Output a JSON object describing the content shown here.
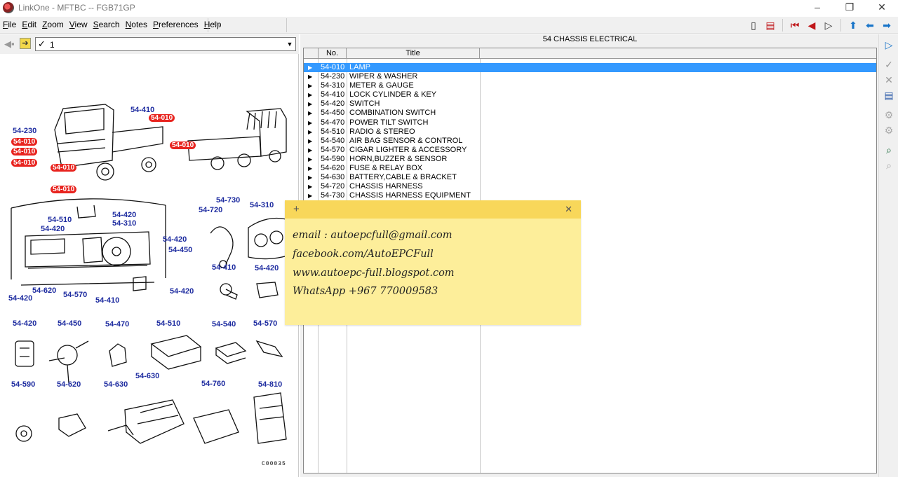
{
  "window": {
    "title": "LinkOne - MFTBC -- FGB71GP",
    "controls": [
      "–",
      "❐",
      "✕"
    ]
  },
  "menu": {
    "items": [
      "File",
      "Edit",
      "Zoom",
      "View",
      "Search",
      "Notes",
      "Preferences",
      "Help"
    ]
  },
  "left": {
    "combo_value": "1",
    "callouts": {
      "c_54410a": "54-410",
      "c_54010a": "54-010",
      "c_54230": "54-230",
      "c_54010b": "54-010",
      "c_54010c": "54-010",
      "c_54010d": "54-010",
      "c_54010e": "54-010",
      "c_54010f": "54-010",
      "c_54010g": "54-010",
      "c_54730a": "54-730",
      "c_54720": "54-720",
      "c_54310a": "54-310",
      "c_54510a": "54-510",
      "c_54420a": "54-420",
      "c_54420b": "54-420",
      "c_54310b": "54-310",
      "c_54420c": "54-420",
      "c_54450a": "54-450",
      "c_54420d": "54-420",
      "c_54620a": "54-620",
      "c_54420e": "54-420",
      "c_54570a": "54-570",
      "c_54410b": "54-410",
      "c_54410c": "54-410",
      "c_54420f": "54-420",
      "c_54420g": "54-420",
      "c_54450b": "54-450",
      "c_54470": "54-470",
      "c_54510b": "54-510",
      "c_54540": "54-540",
      "c_54570b": "54-570",
      "c_54590": "54-590",
      "c_54620b": "54-620",
      "c_54630a": "54-630",
      "c_54630b": "54-630",
      "c_54760": "54-760",
      "c_54810": "54-810"
    },
    "catalog_code": "C00035"
  },
  "right": {
    "section_title": "54 CHASSIS ELECTRICAL",
    "columns": {
      "no": "No.",
      "title": "Title"
    },
    "rows": [
      {
        "no": "54-010",
        "title": "LAMP",
        "selected": true
      },
      {
        "no": "54-230",
        "title": "WIPER & WASHER"
      },
      {
        "no": "54-310",
        "title": "METER & GAUGE"
      },
      {
        "no": "54-410",
        "title": "LOCK CYLINDER & KEY"
      },
      {
        "no": "54-420",
        "title": "SWITCH"
      },
      {
        "no": "54-450",
        "title": "COMBINATION SWITCH"
      },
      {
        "no": "54-470",
        "title": "POWER TILT SWITCH"
      },
      {
        "no": "54-510",
        "title": "RADIO & STEREO"
      },
      {
        "no": "54-540",
        "title": "AIR BAG SENSOR & CONTROL"
      },
      {
        "no": "54-570",
        "title": "CIGAR LIGHTER & ACCESSORY"
      },
      {
        "no": "54-590",
        "title": "HORN,BUZZER & SENSOR"
      },
      {
        "no": "54-620",
        "title": "FUSE & RELAY BOX"
      },
      {
        "no": "54-630",
        "title": "BATTERY,CABLE & BRACKET"
      },
      {
        "no": "54-720",
        "title": "CHASSIS HARNESS"
      },
      {
        "no": "54-730",
        "title": "CHASSIS HARNESS EQUIPMENT"
      }
    ]
  },
  "note": {
    "add": "+",
    "close": "✕",
    "lines": [
      "email : autoepcfull@gmail.com",
      "facebook.com/AutoEPCFull",
      "www.autoepc-full.blogspot.com",
      "WhatsApp +967 770009583"
    ]
  },
  "colors": {
    "selection": "#3399ff",
    "callout_blue": "#1e2ca0",
    "callout_red": "#e8241f",
    "note_body": "#fdee9a",
    "note_header": "#f8d75a"
  }
}
